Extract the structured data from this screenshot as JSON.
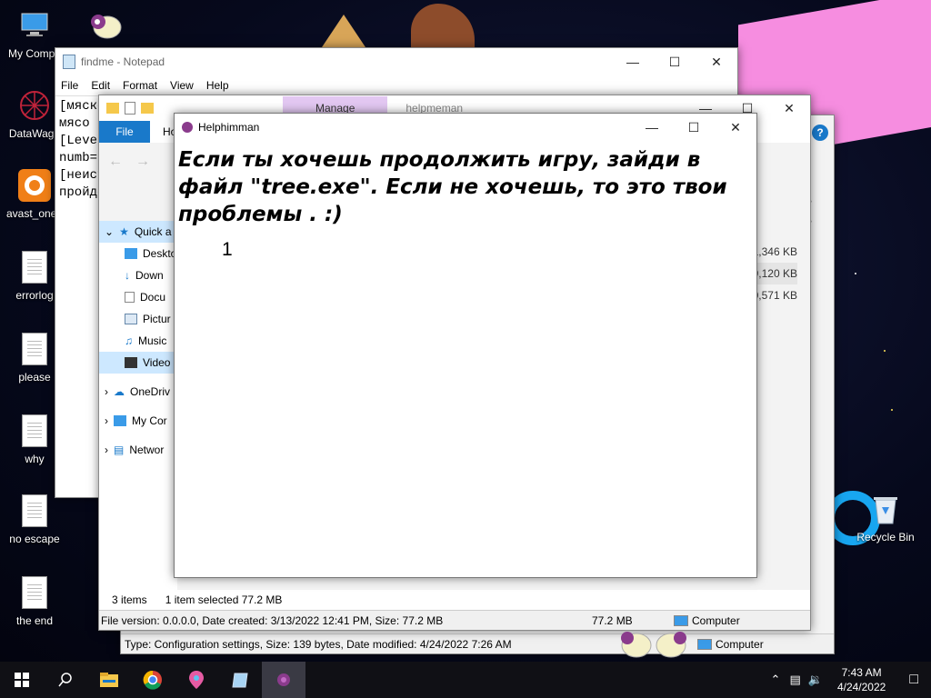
{
  "desktop": {
    "icons": [
      {
        "label": "My Compu",
        "icon": "computer-icon"
      },
      {
        "label": "DataWago",
        "icon": "app-icon"
      },
      {
        "label": "avast_one_",
        "icon": "avast-icon"
      },
      {
        "label": "errorlog",
        "icon": "text-file-icon"
      },
      {
        "label": "please",
        "icon": "text-file-icon"
      },
      {
        "label": "why",
        "icon": "text-file-icon"
      },
      {
        "label": "no escape",
        "icon": "text-file-icon"
      },
      {
        "label": "the end",
        "icon": "text-file-icon"
      }
    ],
    "recycle_bin": "Recycle Bin"
  },
  "notepad": {
    "title": "findme - Notepad",
    "menu": [
      "File",
      "Edit",
      "Format",
      "View",
      "Help"
    ],
    "lines": [
      "[мяско",
      "мясо -",
      "[Level",
      "numb=-",
      "[неист",
      "пройдё"
    ]
  },
  "explorer": {
    "manage_tab": "Manage",
    "title": "helpmeman",
    "tabs": {
      "file": "File",
      "home": "Ho"
    },
    "nav": {
      "quick_access": "Quick a",
      "items": [
        "Deskto",
        "Down",
        "Docu",
        "Pictur",
        "Music",
        "Video"
      ],
      "onedrive": "OneDriv",
      "my_computer": "My Cor",
      "network": "Networ"
    },
    "sizes": [
      "1,346 KB",
      "9,120 KB",
      "0,571 KB"
    ],
    "sizes_back": [
      "KB",
      "KB"
    ],
    "status": {
      "items": "3 items",
      "selected": "1 item selected  77.2 MB"
    },
    "details_bar": {
      "text": "File version: 0.0.0.0, Date created: 3/13/2022 12:41 PM, Size: 77.2 MB",
      "size": "77.2 MB",
      "location": "Computer"
    }
  },
  "explorer2": {
    "details_bar": {
      "text": "Type: Configuration settings, Size: 139 bytes, Date modified: 4/24/2022 7:26 AM",
      "location": "Computer"
    }
  },
  "dialog": {
    "title": "Helphimman",
    "message": "Если ты хочешь продолжить игру, зайди в файл \"tree.exe\". Если не хочешь, то это твои проблемы . :)",
    "number": "1"
  },
  "taskbar": {
    "apps": [
      "start-icon",
      "search-icon",
      "file-explorer-icon",
      "chrome-icon",
      "maps-icon",
      "notepad-icon",
      "helphimman-icon"
    ],
    "time": "7:43 AM",
    "date": "4/24/2022"
  },
  "colors": {
    "accent": "#1979ca",
    "dialog_bg": "#ffffff",
    "taskbar": "#101015"
  }
}
